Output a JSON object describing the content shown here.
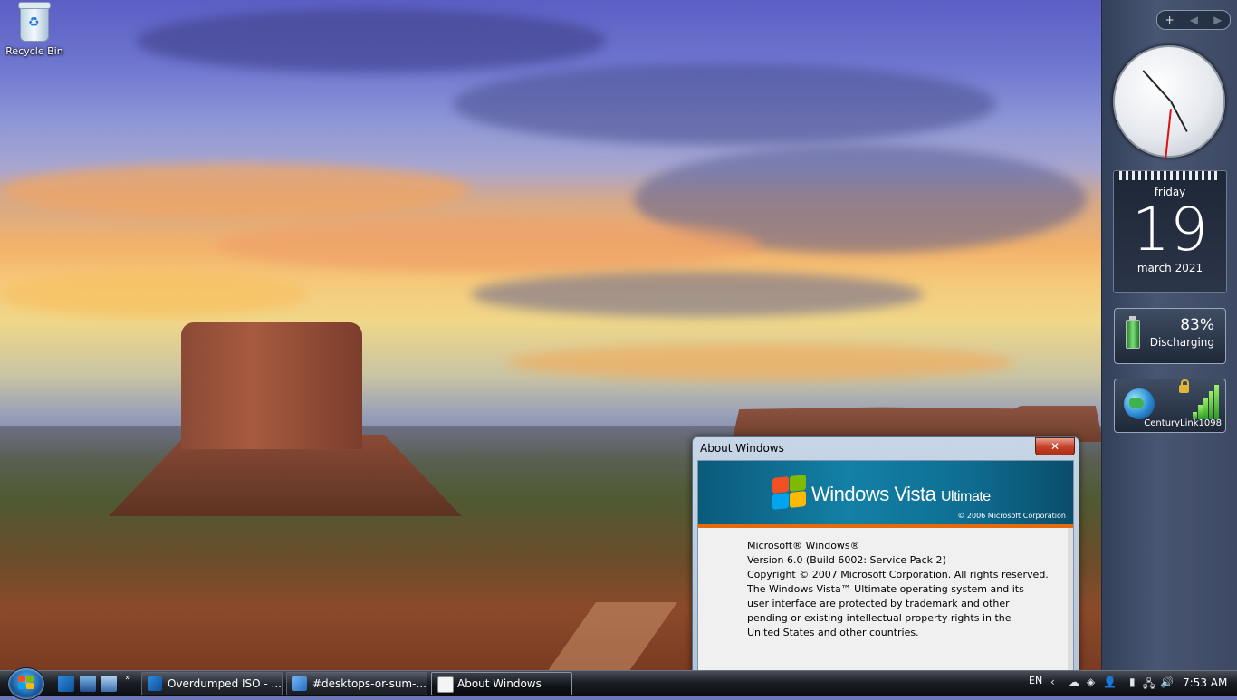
{
  "desktop": {
    "icons": [
      {
        "label": "Recycle Bin",
        "icon": "recycle-bin-icon"
      }
    ]
  },
  "sidebar": {
    "controls": {
      "add": "+",
      "prev": "◀",
      "next": "▶"
    },
    "calendar": {
      "day": "friday",
      "date": "19",
      "month": "march 2021"
    },
    "battery": {
      "percent": "83%",
      "status": "Discharging"
    },
    "network": {
      "ssid": "CenturyLink1098"
    }
  },
  "about_window": {
    "title": "About Windows",
    "close_label": "✕",
    "brand_main": "Windows Vista",
    "brand_edition": "Ultimate",
    "banner_copyright": "© 2006 Microsoft Corporation",
    "lines": [
      "Microsoft® Windows®",
      "Version 6.0 (Build 6002: Service Pack 2)",
      "Copyright © 2007 Microsoft Corporation.  All rights reserved.",
      "The Windows Vista™ Ultimate operating system and its user interface are protected by trademark and other pending or existing intellectual property rights in the United States and other countries."
    ]
  },
  "taskbar": {
    "quick_launch_more": "»",
    "tasks": [
      {
        "label": "Overdumped ISO - ..."
      },
      {
        "label": "#desktops-or-sum-..."
      },
      {
        "label": "About Windows"
      }
    ],
    "language": "EN",
    "clock": "7:53 AM"
  },
  "colors": {
    "banner_accent": "#e56a0c",
    "banner_blue": "#1380a6",
    "taskbar": "#1b1e24"
  }
}
